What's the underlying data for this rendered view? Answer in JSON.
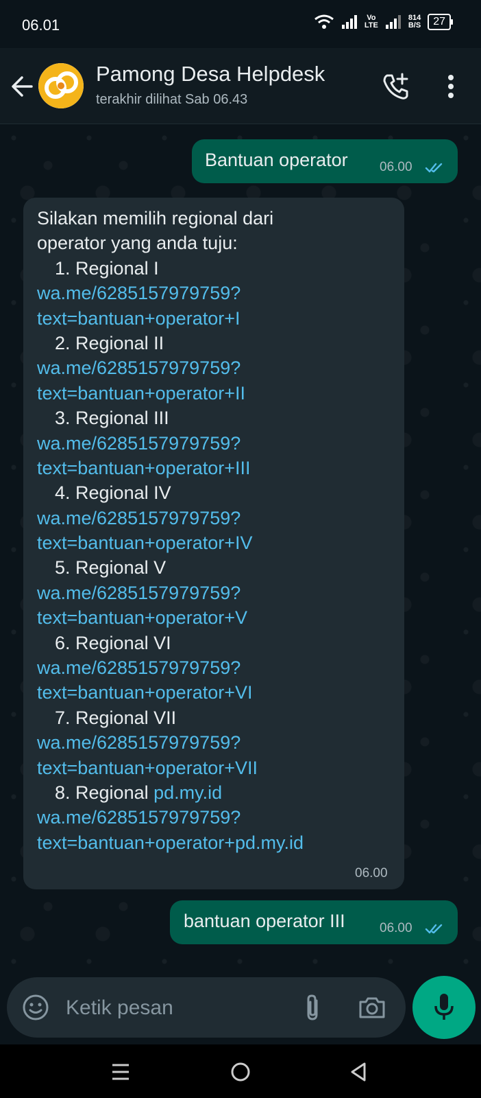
{
  "status_bar": {
    "time": "06.01",
    "network_top": "Vo",
    "network_bottom": "LTE",
    "speed_value": "814",
    "speed_unit": "B/S",
    "battery": "27"
  },
  "header": {
    "contact_name": "Pamong Desa Helpdesk",
    "last_seen": "terakhir dilihat Sab 06.43"
  },
  "messages": {
    "out1": {
      "text": "Bantuan operator",
      "time": "06.00"
    },
    "in1": {
      "time": "06.00",
      "lines": [
        "Silakan memilih regional dari",
        "operator yang anda tuju:",
        "1. Regional I",
        "wa.me/6285157979759?",
        "text=bantuan+operator+I",
        "2. Regional II",
        "wa.me/6285157979759?",
        "text=bantuan+operator+II",
        "3. Regional III",
        "wa.me/6285157979759?",
        "text=bantuan+operator+III",
        "4. Regional IV",
        "wa.me/6285157979759?",
        "text=bantuan+operator+IV",
        "5. Regional V",
        "wa.me/6285157979759?",
        "text=bantuan+operator+V",
        "6. Regional VI",
        "wa.me/6285157979759?",
        "text=bantuan+operator+VI",
        "7. Regional VII",
        "wa.me/6285157979759?",
        "text=bantuan+operator+VII",
        "8. Regional ",
        "pd.my.id",
        "wa.me/6285157979759?",
        "text=bantuan+operator+pd.my.id"
      ]
    },
    "out2": {
      "text": "bantuan operator III",
      "time": "06.00"
    }
  },
  "composer": {
    "placeholder": "Ketik pesan"
  },
  "colors": {
    "background": "#0b141a",
    "header": "#111b21",
    "outgoing_bubble": "#005c4b",
    "incoming_bubble": "#202c33",
    "link": "#53bdeb",
    "read_ticks": "#53bdeb",
    "accent_green": "#00a884"
  },
  "icons": {
    "back": "arrow-left-icon",
    "call": "phone-add-icon",
    "menu": "more-vertical-icon",
    "emoji": "smiley-icon",
    "attach": "paperclip-icon",
    "camera": "camera-icon",
    "mic": "microphone-icon",
    "nav_menu": "menu-lines-icon",
    "nav_home": "home-circle-icon",
    "nav_back": "triangle-back-icon"
  }
}
